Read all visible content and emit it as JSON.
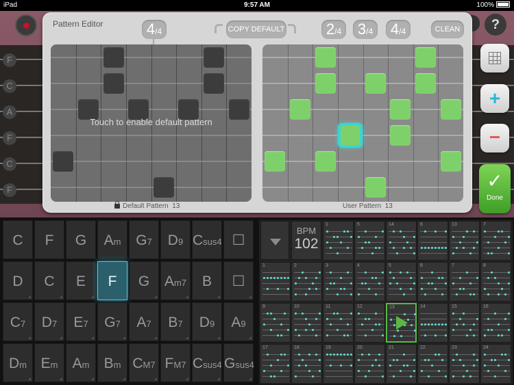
{
  "status": {
    "device": "iPad",
    "time": "9:57 AM",
    "battery": "100%"
  },
  "strings": [
    "F",
    "C",
    "A",
    "F",
    "C",
    "F"
  ],
  "help_label": "?",
  "editor": {
    "title": "Pattern Editor",
    "left_sig": {
      "num": "4",
      "den": "/4"
    },
    "copy_default": "COPY DEFAULT",
    "sig_options": [
      {
        "num": "2",
        "den": "/4"
      },
      {
        "num": "3",
        "den": "/4"
      },
      {
        "num": "4",
        "den": "/4"
      }
    ],
    "clean": "CLEAN",
    "overlay": "Touch to enable default pattern",
    "default_caption": "Default Pattern",
    "default_num": "13",
    "user_caption": "User Pattern",
    "user_num": "13"
  },
  "tools": {
    "plus": "+",
    "minus": "−"
  },
  "done": {
    "check": "✓",
    "label": "Done"
  },
  "chords": [
    [
      {
        "m": "C",
        "s": ""
      },
      {
        "m": "F",
        "s": ""
      },
      {
        "m": "G",
        "s": ""
      },
      {
        "m": "A",
        "s": "m"
      },
      {
        "m": "G",
        "s": "7"
      },
      {
        "m": "D",
        "s": "9"
      },
      {
        "m": "C",
        "s": "sus4"
      },
      {
        "m": "☐",
        "s": ""
      }
    ],
    [
      {
        "m": "D",
        "s": ""
      },
      {
        "m": "C",
        "s": ""
      },
      {
        "m": "E",
        "s": ""
      },
      {
        "m": "F",
        "s": ""
      },
      {
        "m": "G",
        "s": ""
      },
      {
        "m": "A",
        "s": "m7"
      },
      {
        "m": "B",
        "s": ""
      },
      {
        "m": "☐",
        "s": ""
      }
    ],
    [
      {
        "m": "C",
        "s": "7"
      },
      {
        "m": "D",
        "s": "7"
      },
      {
        "m": "E",
        "s": "7"
      },
      {
        "m": "G",
        "s": "7"
      },
      {
        "m": "A",
        "s": "7"
      },
      {
        "m": "B",
        "s": "7"
      },
      {
        "m": "D",
        "s": "9"
      },
      {
        "m": "A",
        "s": "9"
      }
    ],
    [
      {
        "m": "D",
        "s": "m"
      },
      {
        "m": "E",
        "s": "m"
      },
      {
        "m": "A",
        "s": "m"
      },
      {
        "m": "B",
        "s": "m"
      },
      {
        "m": "C",
        "s": "M7"
      },
      {
        "m": "F",
        "s": "M7"
      },
      {
        "m": "C",
        "s": "sus4"
      },
      {
        "m": "G",
        "s": "sus4"
      }
    ]
  ],
  "active_chord": "F",
  "bpm": {
    "label": "BPM",
    "value": "102"
  },
  "patterns": [
    [
      "1",
      "5",
      "14",
      "6",
      "13",
      "7"
    ],
    [
      "1",
      "2",
      "3",
      "4",
      "5",
      "6",
      "7",
      "8"
    ],
    [
      "9",
      "10",
      "11",
      "12",
      "13",
      "14",
      "15",
      "16"
    ],
    [
      "17",
      "18",
      "19",
      "20",
      "21",
      "22",
      "23",
      "24"
    ]
  ],
  "playing_pattern": "13",
  "colors": {
    "accent": "#5bd3c6",
    "green": "#7ed16a",
    "done": "#4caf30"
  }
}
